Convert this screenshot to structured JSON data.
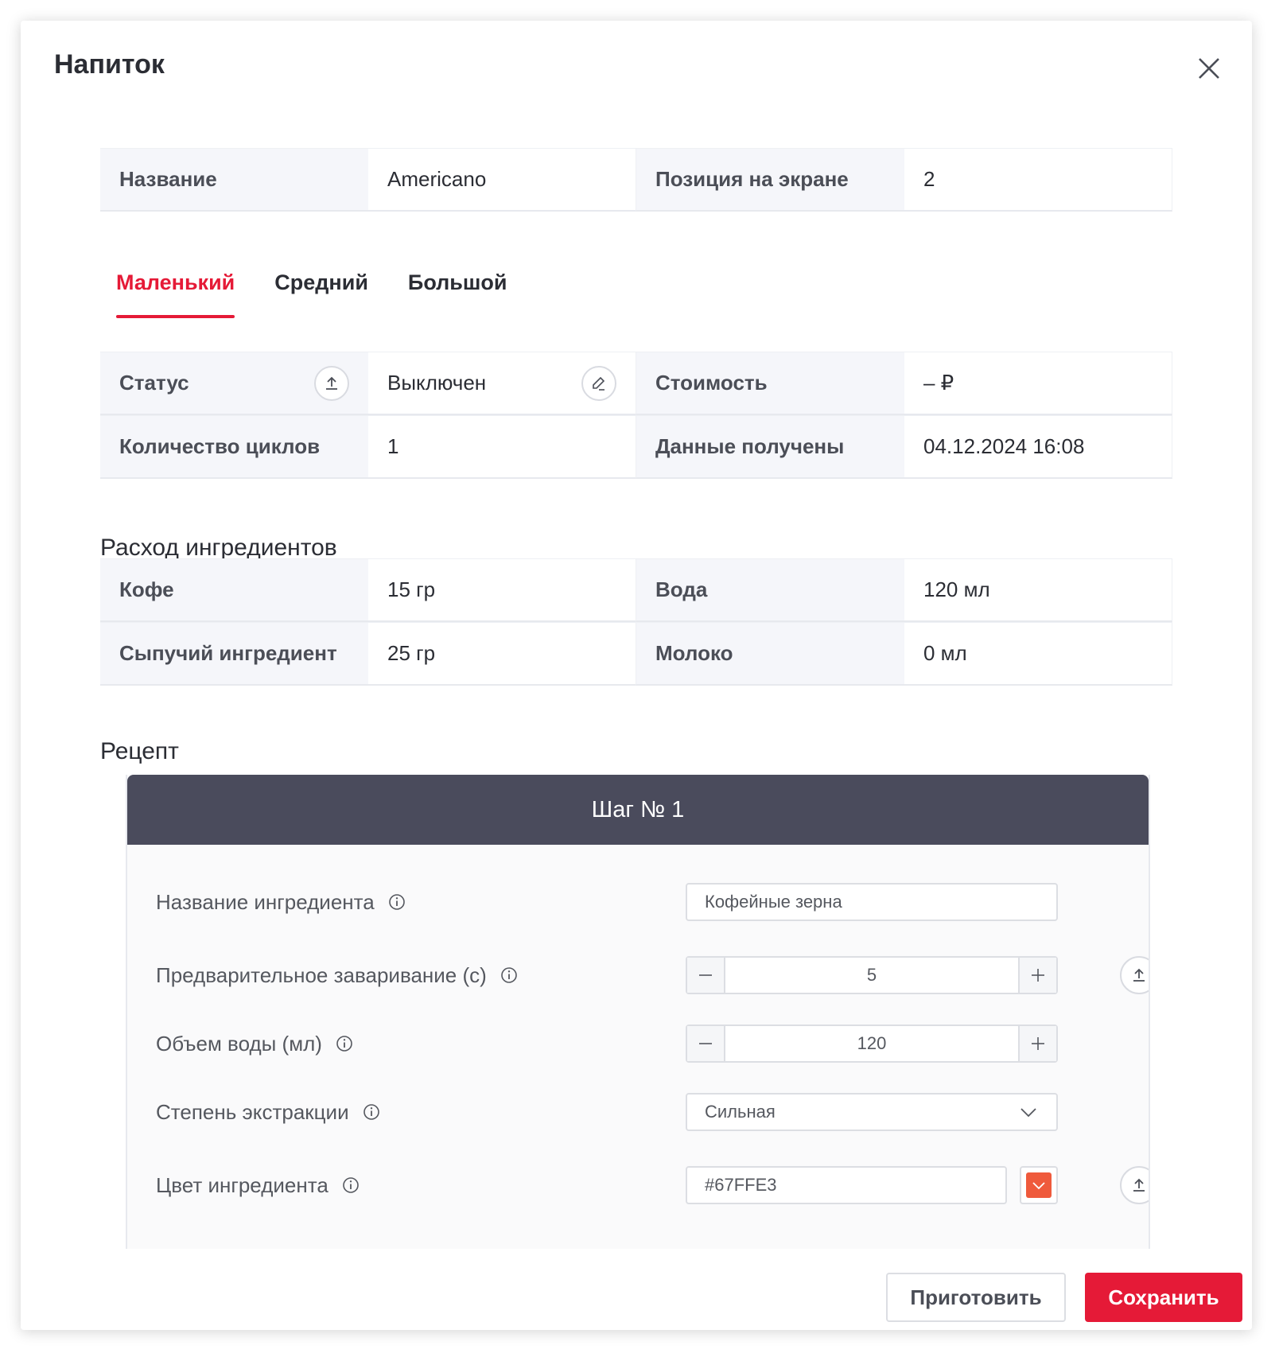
{
  "modal": {
    "title": "Напиток"
  },
  "drink": {
    "name_label": "Название",
    "name_value": "Americano",
    "position_label": "Позиция на экране",
    "position_value": "2"
  },
  "tabs": [
    {
      "label": "Маленький",
      "active": true
    },
    {
      "label": "Средний",
      "active": false
    },
    {
      "label": "Большой",
      "active": false
    }
  ],
  "status": {
    "status_label": "Статус",
    "status_value": "Выключен",
    "cost_label": "Стоимость",
    "cost_value": "– ₽",
    "cycles_label": "Количество циклов",
    "cycles_value": "1",
    "received_label": "Данные получены",
    "received_value": "04.12.2024 16:08"
  },
  "ingredients": {
    "title": "Расход ингредиентов",
    "coffee_label": "Кофе",
    "coffee_value": "15 гр",
    "water_label": "Вода",
    "water_value": "120 мл",
    "bulk_label": "Сыпучий ингредиент",
    "bulk_value": "25 гр",
    "milk_label": "Молоко",
    "milk_value": "0 мл"
  },
  "recipe": {
    "title": "Рецепт",
    "step": {
      "header": "Шаг № 1",
      "ingredient_name_label": "Название ингредиента",
      "ingredient_name_value": "Кофейные зерна",
      "prebrew_label": "Предварительное заваривание (с)",
      "prebrew_value": "5",
      "water_volume_label": "Объем воды (мл)",
      "water_volume_value": "120",
      "extraction_label": "Степень экстракции",
      "extraction_value": "Сильная",
      "color_label": "Цвет ингредиента",
      "color_value": "#67FFE3"
    }
  },
  "footer": {
    "prepare_label": "Приготовить",
    "save_label": "Сохранить"
  },
  "colors": {
    "accent": "#e51a37",
    "step_header_bg": "#4a4b5c",
    "swatch": "#ef5a3c"
  },
  "icons": {
    "close": "close-icon",
    "upload": "upload-icon",
    "edit": "edit-icon",
    "info": "info-icon",
    "minus": "minus-icon",
    "plus": "plus-icon",
    "chevron": "chevron-down-icon"
  }
}
